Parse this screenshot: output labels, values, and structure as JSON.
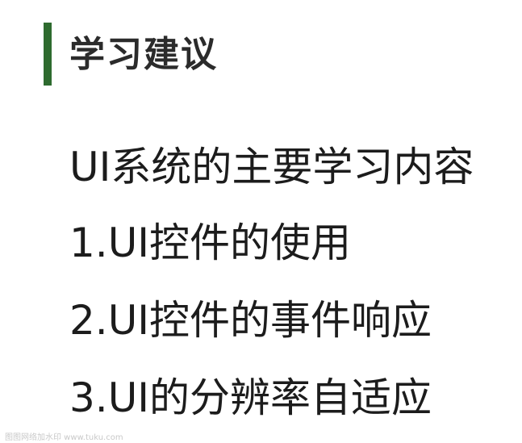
{
  "slide": {
    "title": "学习建议",
    "accent_color": "#2e6b2f",
    "lines": [
      "UI系统的主要学习内容",
      "1.UI控件的使用",
      "2.UI控件的事件响应",
      "3.UI的分辨率自适应"
    ],
    "watermark": "图图网络加水印 www.tuku.com"
  }
}
